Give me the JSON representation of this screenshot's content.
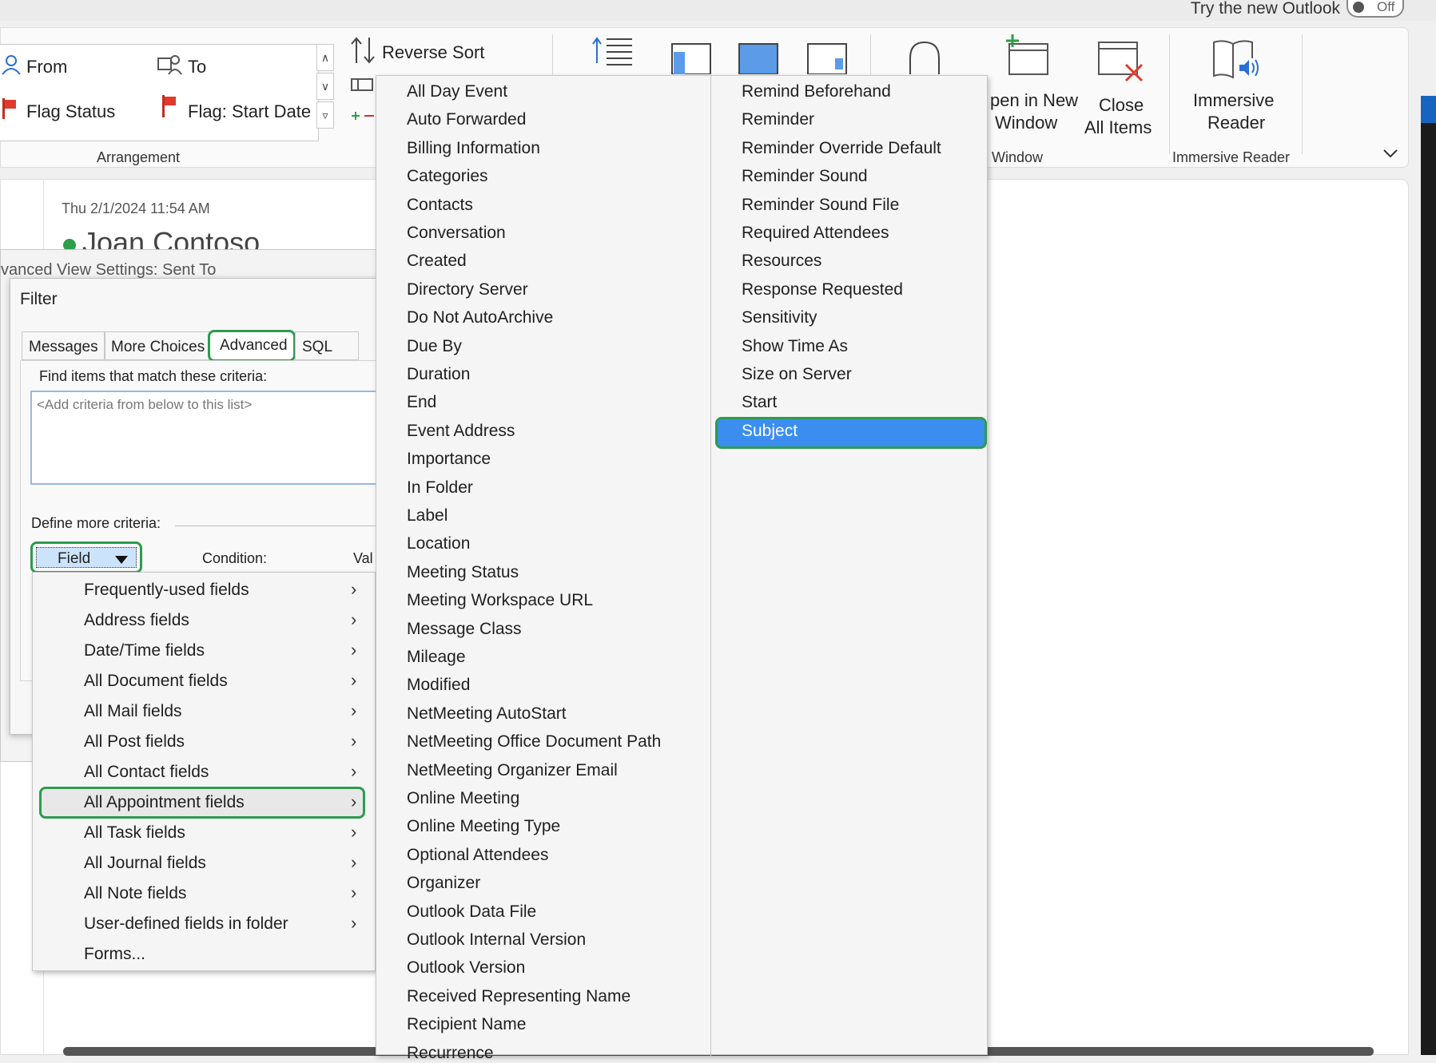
{
  "topbar": {
    "try_new": "Try the new Outlook",
    "toggle_label": "Off"
  },
  "ribbon": {
    "arrangement": {
      "from": "From",
      "to": "To",
      "flag_status": "Flag Status",
      "flag_start_date": "Flag: Start Date",
      "group_label": "Arrangement"
    },
    "reverse_sort": "Reverse Sort",
    "window": {
      "open_new_line1": "pen in New",
      "open_new_line2": "Window",
      "close_all_line1": "Close",
      "close_all_line2": "All Items",
      "group_label": "Window"
    },
    "immersive": {
      "line1": "Immersive",
      "line2": "Reader",
      "group_label": "Immersive Reader"
    }
  },
  "message": {
    "date": "Thu 2/1/2024 11:54 AM",
    "sender": "Joan Contoso"
  },
  "adv_dialog": {
    "title": "vanced View Settings: Sent To"
  },
  "filter": {
    "title": "Filter",
    "tabs": [
      "Messages",
      "More Choices",
      "Advanced",
      "SQL"
    ],
    "find_label": "Find items that match these criteria:",
    "criteria_placeholder": "<Add criteria from below to this list>",
    "define_more": "Define more criteria:",
    "field_button": "Field",
    "condition_label": "Condition:",
    "value_label": "Val"
  },
  "field_menu": [
    "Frequently-used fields",
    "Address fields",
    "Date/Time fields",
    "All Document fields",
    "All Mail fields",
    "All Post fields",
    "All Contact fields",
    "All Appointment fields",
    "All Task fields",
    "All Journal fields",
    "All Note fields",
    "User-defined fields in folder",
    "Forms..."
  ],
  "appointment_fields_col1": [
    "All Day Event",
    "Auto Forwarded",
    "Billing Information",
    "Categories",
    "Contacts",
    "Conversation",
    "Created",
    "Directory Server",
    "Do Not AutoArchive",
    "Due By",
    "Duration",
    "End",
    "Event Address",
    "Importance",
    "In Folder",
    "Label",
    "Location",
    "Meeting Status",
    "Meeting Workspace URL",
    "Message Class",
    "Mileage",
    "Modified",
    "NetMeeting AutoStart",
    "NetMeeting Office Document Path",
    "NetMeeting Organizer Email",
    "Online Meeting",
    "Online Meeting Type",
    "Optional Attendees",
    "Organizer",
    "Outlook Data File",
    "Outlook Internal Version",
    "Outlook Version",
    "Received Representing Name",
    "Recipient Name",
    "Recurrence"
  ],
  "appointment_fields_col2": [
    "Remind Beforehand",
    "Reminder",
    "Reminder Override Default",
    "Reminder Sound",
    "Reminder Sound File",
    "Required Attendees",
    "Resources",
    "Response Requested",
    "Sensitivity",
    "Show Time As",
    "Size on Server",
    "Start",
    "Subject"
  ],
  "colors": {
    "selected": "#3b8ef0",
    "highlight_ring": "#2e9b4f"
  }
}
